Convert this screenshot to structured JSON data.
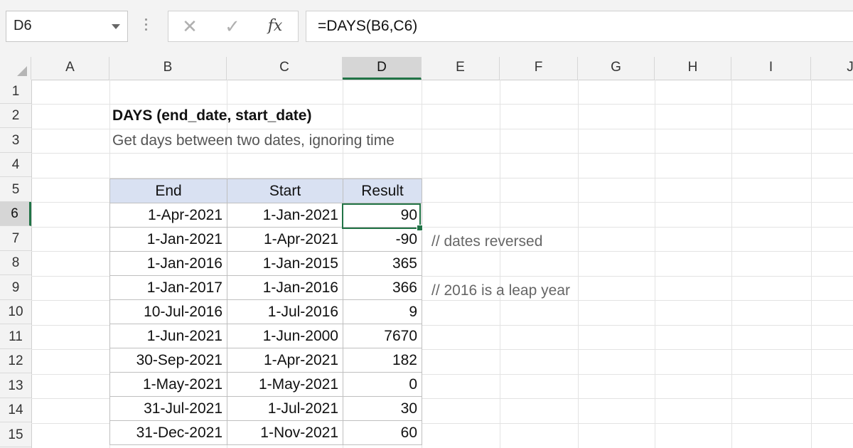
{
  "name_box": {
    "value": "D6"
  },
  "formula_bar": {
    "cancel_icon": "x-icon",
    "enter_icon": "check-icon",
    "fx_label": "fx",
    "formula": "=DAYS(B6,C6)"
  },
  "columns": [
    "A",
    "B",
    "C",
    "D",
    "E",
    "F",
    "G",
    "H",
    "I",
    "J"
  ],
  "active_column": "D",
  "rows": [
    "1",
    "2",
    "3",
    "4",
    "5",
    "6",
    "7",
    "8",
    "9",
    "10",
    "11",
    "12",
    "13",
    "14",
    "15"
  ],
  "active_row": "6",
  "sheet": {
    "title": "DAYS (end_date, start_date)",
    "subtitle": "Get days between two dates, ignoring time",
    "table": {
      "headers": [
        "End",
        "Start",
        "Result"
      ],
      "rows": [
        [
          "1-Apr-2021",
          "1-Jan-2021",
          "90"
        ],
        [
          "1-Jan-2021",
          "1-Apr-2021",
          "-90"
        ],
        [
          "1-Jan-2016",
          "1-Jan-2015",
          "365"
        ],
        [
          "1-Jan-2017",
          "1-Jan-2016",
          "366"
        ],
        [
          "10-Jul-2016",
          "1-Jul-2016",
          "9"
        ],
        [
          "1-Jun-2021",
          "1-Jun-2000",
          "7670"
        ],
        [
          "30-Sep-2021",
          "1-Apr-2021",
          "182"
        ],
        [
          "1-May-2021",
          "1-May-2021",
          "0"
        ],
        [
          "31-Jul-2021",
          "1-Jul-2021",
          "30"
        ],
        [
          "31-Dec-2021",
          "1-Nov-2021",
          "60"
        ]
      ]
    },
    "comments": {
      "row7": "// dates reversed",
      "row9": "// 2016 is a leap year"
    }
  },
  "colors": {
    "accent": "#217346",
    "header_fill": "#d9e1f2"
  }
}
